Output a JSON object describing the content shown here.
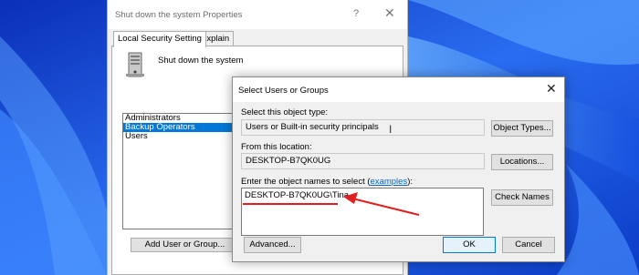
{
  "properties_window": {
    "title": "Shut down the system Properties",
    "help_glyph": "?",
    "close_glyph": "✕",
    "tabs": [
      {
        "label": "Local Security Setting",
        "active": true
      },
      {
        "label": "Explain",
        "active": false
      }
    ],
    "policy_name": "Shut down the system",
    "groups": [
      {
        "label": "Administrators",
        "selected": false
      },
      {
        "label": "Backup Operators",
        "selected": true
      },
      {
        "label": "Users",
        "selected": false
      }
    ],
    "add_button_label": "Add User or Group..."
  },
  "select_dialog": {
    "title": "Select Users or Groups",
    "close_glyph": "✕",
    "object_type_label": "Select this object type:",
    "object_type_value": "Users or Built-in security principals",
    "object_types_button": "Object Types...",
    "location_label": "From this location:",
    "location_value": "DESKTOP-B7QK0UG",
    "locations_button": "Locations...",
    "names_label": "Enter the object names to select (",
    "names_link": "examples",
    "names_label_end": "):",
    "names_value": "DESKTOP-B7QK0UG\\Tina",
    "check_names_button": "Check Names",
    "advanced_button": "Advanced...",
    "ok_button": "OK",
    "cancel_button": "Cancel"
  },
  "colors": {
    "selection": "#0078d7",
    "annotation": "#e02020",
    "wallpaper": "#1b4fd6"
  },
  "icons": [
    "server-tower-icon",
    "close-icon",
    "help-icon",
    "text-cursor-icon"
  ]
}
